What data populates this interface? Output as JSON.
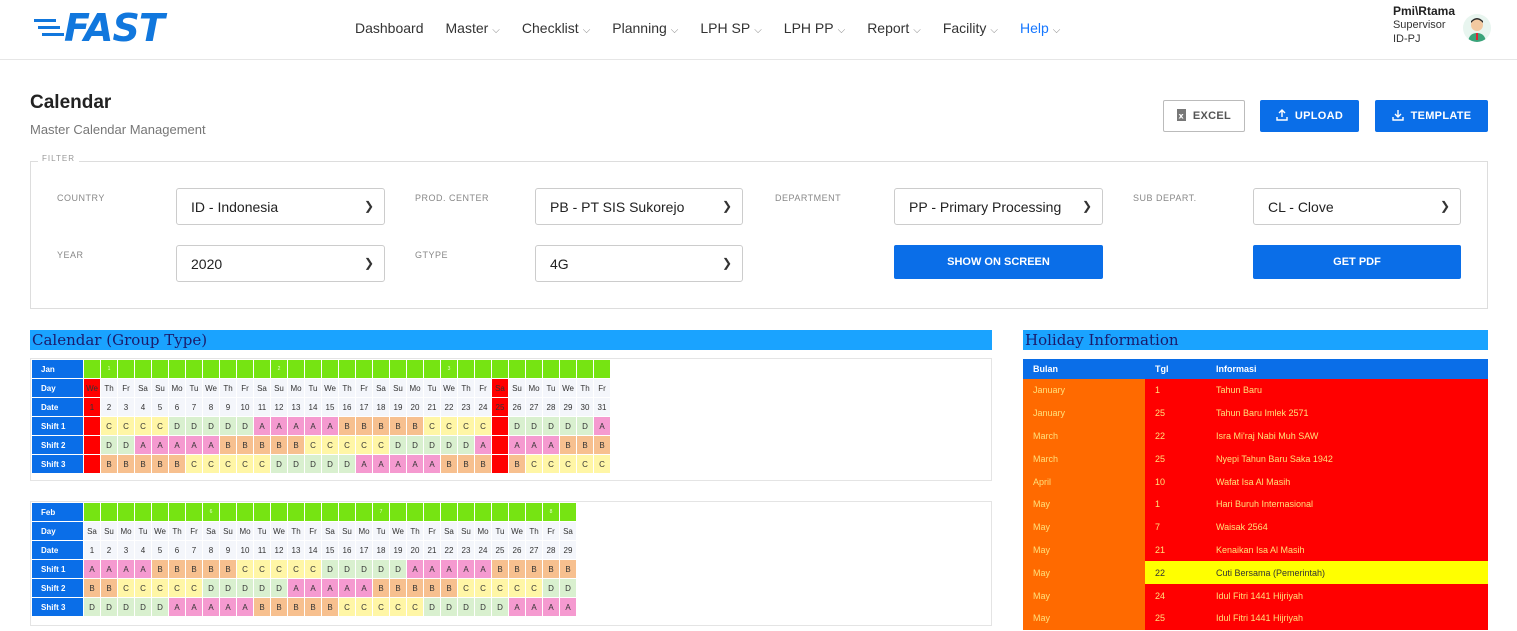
{
  "app": {
    "logo_text": "FAST"
  },
  "nav": [
    {
      "label": "Dashboard",
      "has_dropdown": false
    },
    {
      "label": "Master",
      "has_dropdown": true
    },
    {
      "label": "Checklist",
      "has_dropdown": true
    },
    {
      "label": "Planning",
      "has_dropdown": true
    },
    {
      "label": "LPH SP",
      "has_dropdown": true
    },
    {
      "label": "LPH PP",
      "has_dropdown": true
    },
    {
      "label": "Report",
      "has_dropdown": true
    },
    {
      "label": "Facility",
      "has_dropdown": true
    },
    {
      "label": "Help",
      "has_dropdown": true,
      "active": true
    }
  ],
  "user": {
    "name": "Pmi\\Rtama",
    "role": "Supervisor",
    "location": "ID-PJ"
  },
  "page": {
    "title": "Calendar",
    "subtitle": "Master Calendar Management"
  },
  "actions": {
    "excel": "EXCEL",
    "upload": "UPLOAD",
    "template": "TEMPLATE"
  },
  "filter": {
    "legend": "FILTER",
    "country": {
      "label": "COUNTRY",
      "value": "ID - Indonesia"
    },
    "prod_center": {
      "label": "PROD. CENTER",
      "value": "PB - PT SIS Sukorejo"
    },
    "department": {
      "label": "DEPARTMENT",
      "value": "PP - Primary Processing"
    },
    "sub_depart": {
      "label": "SUB DEPART.",
      "value": "CL - Clove"
    },
    "year": {
      "label": "YEAR",
      "value": "2020"
    },
    "gtype": {
      "label": "GTYPE",
      "value": "4G"
    },
    "show_btn": "SHOW ON SCREEN",
    "pdf_btn": "GET PDF"
  },
  "calendar": {
    "title": "Calendar (Group Type)",
    "row_labels": {
      "day": "Day",
      "date": "Date",
      "shift1": "Shift 1",
      "shift2": "Shift 2",
      "shift3": "Shift 3"
    },
    "months": [
      {
        "name": "Jan",
        "week_marks": {
          "1": "1",
          "11": "2",
          "21": "3",
          "31": "4",
          "42": "5"
        },
        "holiday_cols": [
          0,
          24
        ],
        "days": [
          "We",
          "Th",
          "Fr",
          "Sa",
          "Su",
          "Mo",
          "Tu",
          "We",
          "Th",
          "Fr",
          "Sa",
          "Su",
          "Mo",
          "Tu",
          "We",
          "Th",
          "Fr",
          "Sa",
          "Su",
          "Mo",
          "Tu",
          "We",
          "Th",
          "Fr",
          "Sa",
          "Su",
          "Mo",
          "Tu",
          "We",
          "Th",
          "Fr"
        ],
        "dates": [
          "1",
          "2",
          "3",
          "4",
          "5",
          "6",
          "7",
          "8",
          "9",
          "10",
          "11",
          "12",
          "13",
          "14",
          "15",
          "16",
          "17",
          "18",
          "19",
          "20",
          "21",
          "22",
          "23",
          "24",
          "25",
          "26",
          "27",
          "28",
          "29",
          "30",
          "31"
        ],
        "shift1": [
          "",
          "C",
          "C",
          "C",
          "C",
          "D",
          "D",
          "D",
          "D",
          "D",
          "A",
          "A",
          "A",
          "A",
          "A",
          "B",
          "B",
          "B",
          "B",
          "B",
          "C",
          "C",
          "C",
          "C",
          "",
          "D",
          "D",
          "D",
          "D",
          "D",
          "A"
        ],
        "shift2": [
          "",
          "D",
          "D",
          "A",
          "A",
          "A",
          "A",
          "A",
          "B",
          "B",
          "B",
          "B",
          "B",
          "C",
          "C",
          "C",
          "C",
          "C",
          "D",
          "D",
          "D",
          "D",
          "D",
          "A",
          "",
          "A",
          "A",
          "A",
          "B",
          "B",
          "B"
        ],
        "shift3": [
          "",
          "B",
          "B",
          "B",
          "B",
          "B",
          "C",
          "C",
          "C",
          "C",
          "C",
          "D",
          "D",
          "D",
          "D",
          "D",
          "A",
          "A",
          "A",
          "A",
          "A",
          "B",
          "B",
          "B",
          "",
          "B",
          "C",
          "C",
          "C",
          "C",
          "C"
        ]
      },
      {
        "name": "Feb",
        "week_marks": {
          "7": "6",
          "17": "7",
          "27": "8",
          "37": "9"
        },
        "holiday_cols": [],
        "days": [
          "Sa",
          "Su",
          "Mo",
          "Tu",
          "We",
          "Th",
          "Fr",
          "Sa",
          "Su",
          "Mo",
          "Tu",
          "We",
          "Th",
          "Fr",
          "Sa",
          "Su",
          "Mo",
          "Tu",
          "We",
          "Th",
          "Fr",
          "Sa",
          "Su",
          "Mo",
          "Tu",
          "We",
          "Th",
          "Fr",
          "Sa"
        ],
        "dates": [
          "1",
          "2",
          "3",
          "4",
          "5",
          "6",
          "7",
          "8",
          "9",
          "10",
          "11",
          "12",
          "13",
          "14",
          "15",
          "16",
          "17",
          "18",
          "19",
          "20",
          "21",
          "22",
          "23",
          "24",
          "25",
          "26",
          "27",
          "28",
          "29"
        ],
        "shift1": [
          "A",
          "A",
          "A",
          "A",
          "B",
          "B",
          "B",
          "B",
          "B",
          "C",
          "C",
          "C",
          "C",
          "C",
          "D",
          "D",
          "D",
          "D",
          "D",
          "A",
          "A",
          "A",
          "A",
          "A",
          "B",
          "B",
          "B",
          "B",
          "B"
        ],
        "shift2": [
          "B",
          "B",
          "C",
          "C",
          "C",
          "C",
          "C",
          "D",
          "D",
          "D",
          "D",
          "D",
          "A",
          "A",
          "A",
          "A",
          "A",
          "B",
          "B",
          "B",
          "B",
          "B",
          "C",
          "C",
          "C",
          "C",
          "C",
          "D",
          "D"
        ],
        "shift3": [
          "D",
          "D",
          "D",
          "D",
          "D",
          "A",
          "A",
          "A",
          "A",
          "A",
          "B",
          "B",
          "B",
          "B",
          "B",
          "C",
          "C",
          "C",
          "C",
          "C",
          "D",
          "D",
          "D",
          "D",
          "D",
          "A",
          "A",
          "A",
          "A"
        ]
      }
    ]
  },
  "holidays": {
    "title": "Holiday Information",
    "headers": {
      "month": "Bulan",
      "date": "Tgl",
      "info": "Informasi"
    },
    "rows": [
      {
        "month": "January",
        "date": "1",
        "info": "Tahun Baru",
        "type": "holiday"
      },
      {
        "month": "January",
        "date": "25",
        "info": "Tahun Baru Imlek 2571",
        "type": "holiday"
      },
      {
        "month": "March",
        "date": "22",
        "info": "Isra Mi'raj Nabi Muh SAW",
        "type": "holiday"
      },
      {
        "month": "March",
        "date": "25",
        "info": "Nyepi Tahun Baru Saka 1942",
        "type": "holiday"
      },
      {
        "month": "April",
        "date": "10",
        "info": "Wafat Isa Al Masih",
        "type": "holiday"
      },
      {
        "month": "May",
        "date": "1",
        "info": "Hari Buruh Internasional",
        "type": "holiday"
      },
      {
        "month": "May",
        "date": "7",
        "info": "Waisak 2564",
        "type": "holiday"
      },
      {
        "month": "May",
        "date": "21",
        "info": "Kenaikan Isa Al Masih",
        "type": "holiday"
      },
      {
        "month": "May",
        "date": "22",
        "info": "Cuti Bersama (Pemerintah)",
        "type": "cuti"
      },
      {
        "month": "May",
        "date": "24",
        "info": "Idul Fitri 1441 Hijriyah",
        "type": "holiday"
      },
      {
        "month": "May",
        "date": "25",
        "info": "Idul Fitri 1441 Hijriyah",
        "type": "holiday"
      }
    ]
  },
  "colors": {
    "primary": "#0a6ee8",
    "section_head": "#1aa3ff",
    "week_green": "#76e412",
    "holiday_red": "#ff0000",
    "month_orange": "#ff6a00",
    "cuti_yellow": "#ffff00",
    "shift_A": "#f59ad0",
    "shift_B": "#f7c08f",
    "shift_C": "#fff6a6",
    "shift_D": "#d9f0cf"
  }
}
